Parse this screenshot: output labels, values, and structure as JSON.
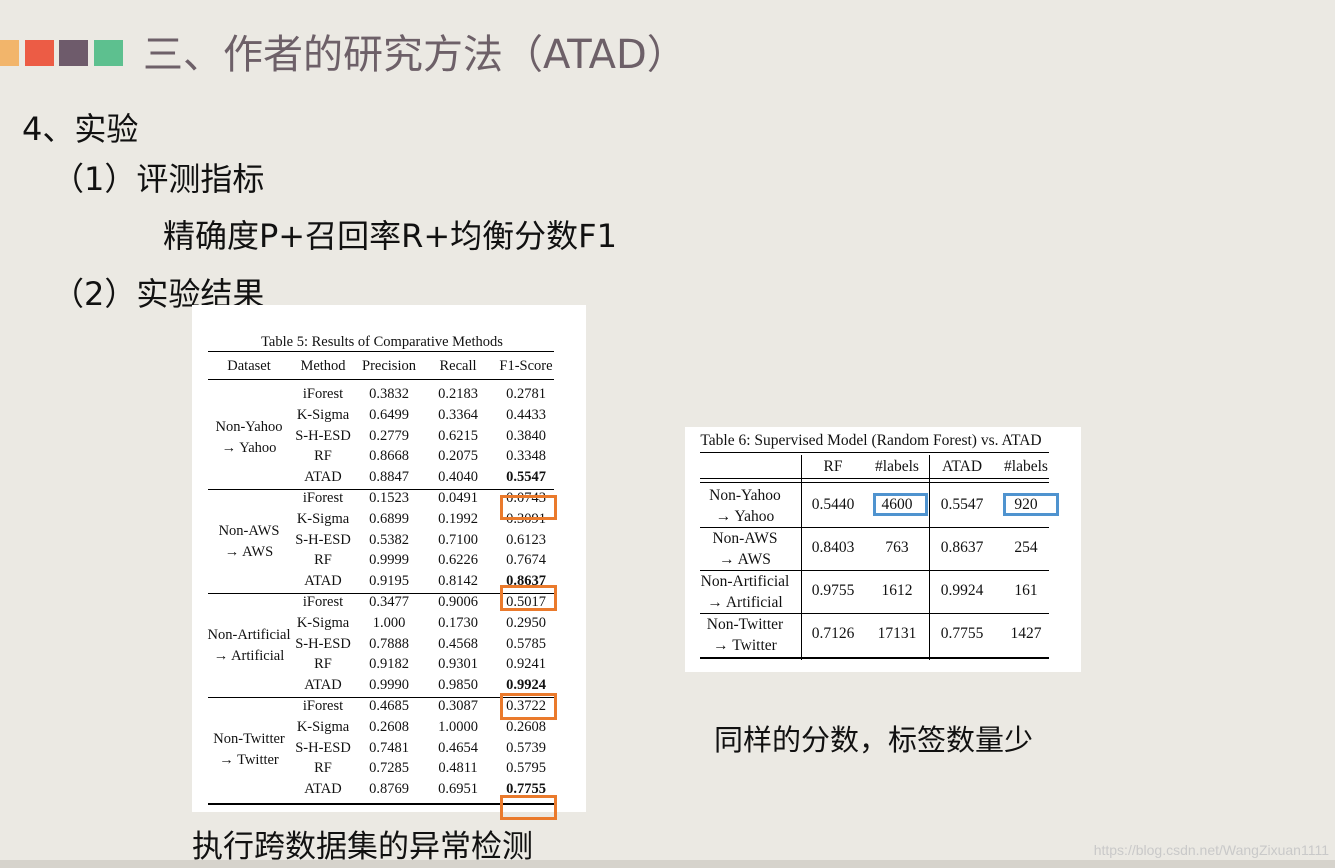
{
  "slide": {
    "title": "三、作者的研究方法（ATAD）",
    "accent_colors": [
      "#f2b56b",
      "#ec5c45",
      "#6e5b6b",
      "#5dc08f"
    ],
    "section": "4、实验",
    "sub1": "（1）评测指标",
    "metrics": "精确度P+召回率R+均衡分数F1",
    "sub2": "（2）实验结果",
    "caption_left": "执行跨数据集的异常检测",
    "caption_right": "同样的分数，标签数量少",
    "watermark": "https://blog.csdn.net/WangZixuan1111"
  },
  "table5": {
    "title": "Table 5: Results of Comparative Methods",
    "headers": [
      "Dataset",
      "Method",
      "Precision",
      "Recall",
      "F1-Score"
    ],
    "groups": [
      {
        "dataset": "Non-Yahoo\n→ Yahoo",
        "rows": [
          [
            "iForest",
            "0.3832",
            "0.2183",
            "0.2781"
          ],
          [
            "K-Sigma",
            "0.6499",
            "0.3364",
            "0.4433"
          ],
          [
            "S-H-ESD",
            "0.2779",
            "0.6215",
            "0.3840"
          ],
          [
            "RF",
            "0.8668",
            "0.2075",
            "0.3348"
          ],
          [
            "ATAD",
            "0.8847",
            "0.4040",
            "0.5547"
          ]
        ]
      },
      {
        "dataset": "Non-AWS\n→ AWS",
        "rows": [
          [
            "iForest",
            "0.1523",
            "0.0491",
            "0.0743"
          ],
          [
            "K-Sigma",
            "0.6899",
            "0.1992",
            "0.3091"
          ],
          [
            "S-H-ESD",
            "0.5382",
            "0.7100",
            "0.6123"
          ],
          [
            "RF",
            "0.9999",
            "0.6226",
            "0.7674"
          ],
          [
            "ATAD",
            "0.9195",
            "0.8142",
            "0.8637"
          ]
        ]
      },
      {
        "dataset": "Non-Artificial\n→ Artificial",
        "rows": [
          [
            "iForest",
            "0.3477",
            "0.9006",
            "0.5017"
          ],
          [
            "K-Sigma",
            "1.000",
            "0.1730",
            "0.2950"
          ],
          [
            "S-H-ESD",
            "0.7888",
            "0.4568",
            "0.5785"
          ],
          [
            "RF",
            "0.9182",
            "0.9301",
            "0.9241"
          ],
          [
            "ATAD",
            "0.9990",
            "0.9850",
            "0.9924"
          ]
        ]
      },
      {
        "dataset": "Non-Twitter\n→ Twitter",
        "rows": [
          [
            "iForest",
            "0.4685",
            "0.3087",
            "0.3722"
          ],
          [
            "K-Sigma",
            "0.2608",
            "1.0000",
            "0.2608"
          ],
          [
            "S-H-ESD",
            "0.7481",
            "0.4654",
            "0.5739"
          ],
          [
            "RF",
            "0.7285",
            "0.4811",
            "0.5795"
          ],
          [
            "ATAD",
            "0.8769",
            "0.6951",
            "0.7755"
          ]
        ]
      }
    ]
  },
  "table6": {
    "title": "Table 6: Supervised Model (Random Forest) vs. ATAD",
    "headers": [
      "RF",
      "#labels",
      "ATAD",
      "#labels"
    ],
    "rows": [
      [
        "Non-Yahoo\n→ Yahoo",
        "0.5440",
        "4600",
        "0.5547",
        "920"
      ],
      [
        "Non-AWS\n→ AWS",
        "0.8403",
        "763",
        "0.8637",
        "254"
      ],
      [
        "Non-Artificial\n→ Artificial",
        "0.9755",
        "1612",
        "0.9924",
        "161"
      ],
      [
        "Non-Twitter\n→ Twitter",
        "0.7126",
        "17131",
        "0.7755",
        "1427"
      ]
    ]
  }
}
